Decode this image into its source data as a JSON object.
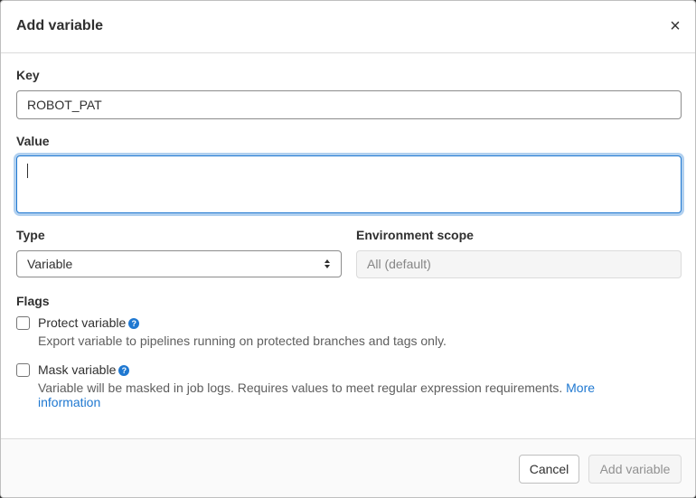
{
  "modal": {
    "title": "Add variable",
    "close_glyph": "×"
  },
  "form": {
    "key_label": "Key",
    "key_value": "ROBOT_PAT",
    "value_label": "Value",
    "value_value": "",
    "type_label": "Type",
    "type_selected": "Variable",
    "env_label": "Environment scope",
    "env_value": "All (default)",
    "flags_label": "Flags",
    "protect": {
      "label": "Protect variable",
      "checked": false,
      "help": "Export variable to pipelines running on protected branches and tags only."
    },
    "mask": {
      "label": "Mask variable",
      "checked": false,
      "help": "Variable will be masked in job logs. Requires values to meet regular expression requirements.",
      "link_text_1": "More",
      "link_text_2": "information"
    }
  },
  "footer": {
    "cancel_label": "Cancel",
    "add_label": "Add variable"
  },
  "colors": {
    "accent": "#1f78d1",
    "help_icon": "#1f78d1"
  },
  "icons": {
    "close": "close-icon",
    "help": "question-circle-icon",
    "select_arrows": "chevron-up-down-icon"
  }
}
